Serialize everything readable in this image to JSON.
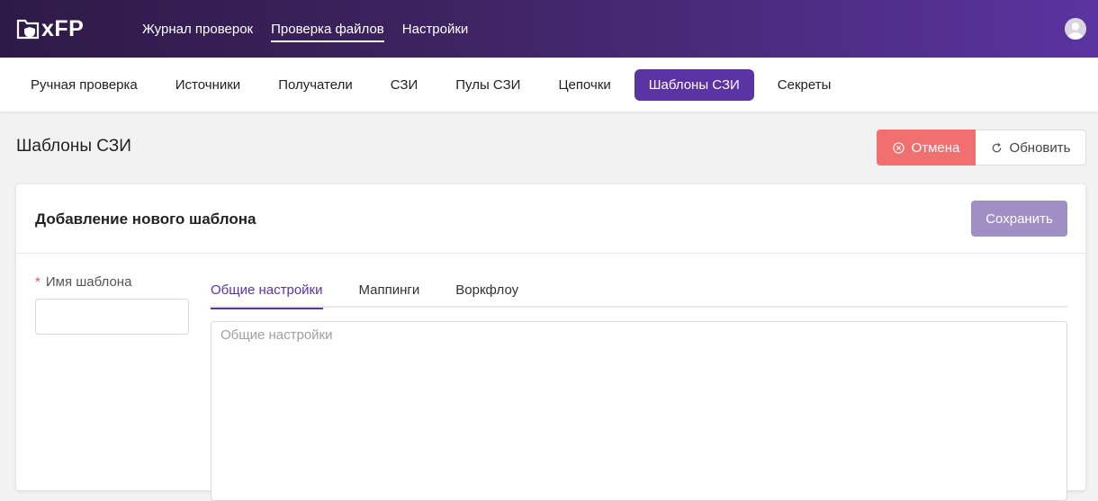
{
  "app": {
    "logo_text": "xFP",
    "accent": "#5b34a3"
  },
  "topnav": {
    "items": [
      {
        "label": "Журнал проверок",
        "active": false
      },
      {
        "label": "Проверка файлов",
        "active": true
      },
      {
        "label": "Настройки",
        "active": false
      }
    ]
  },
  "subnav": {
    "items": [
      {
        "label": "Ручная проверка"
      },
      {
        "label": "Источники"
      },
      {
        "label": "Получатели"
      },
      {
        "label": "СЗИ"
      },
      {
        "label": "Пулы СЗИ"
      },
      {
        "label": "Цепочки"
      },
      {
        "label": "Шаблоны СЗИ"
      },
      {
        "label": "Секреты"
      }
    ],
    "active": "Шаблоны СЗИ"
  },
  "page": {
    "title": "Шаблоны СЗИ",
    "cancel_label": "Отмена",
    "refresh_label": "Обновить"
  },
  "card": {
    "title": "Добавление нового шаблона",
    "save_label": "Сохранить",
    "name_label": "Имя шаблона",
    "name_required_mark": "*",
    "name_value": "",
    "tabs": [
      {
        "label": "Общие настройки",
        "active": true
      },
      {
        "label": "Маппинги",
        "active": false
      },
      {
        "label": "Воркфлоу",
        "active": false
      }
    ],
    "settings_placeholder": "Общие настройки"
  },
  "icons": {
    "logo": "shield-folder-icon",
    "avatar": "user-avatar-icon",
    "cancel": "close-circle-icon",
    "refresh": "reload-icon"
  }
}
